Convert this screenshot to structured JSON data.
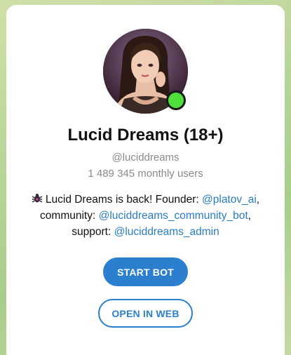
{
  "bot": {
    "title": "Lucid Dreams (18+)",
    "handle": "@luciddreams",
    "monthly_users": "1 489 345 monthly users",
    "online": true
  },
  "description": {
    "icon": "bug-icon",
    "line1_text": "Lucid Dreams is back! Founder: ",
    "founder_link": "@platov_ai",
    "line1_end": ",",
    "line2_text": "community: ",
    "community_link": "@luciddreams_community_bot",
    "line2_end": ",",
    "line3_text": "support: ",
    "support_link": "@luciddreams_admin"
  },
  "buttons": {
    "start_label": "START BOT",
    "web_label": "OPEN IN WEB"
  },
  "colors": {
    "accent": "#2b7fce",
    "online": "#4fe03c"
  }
}
